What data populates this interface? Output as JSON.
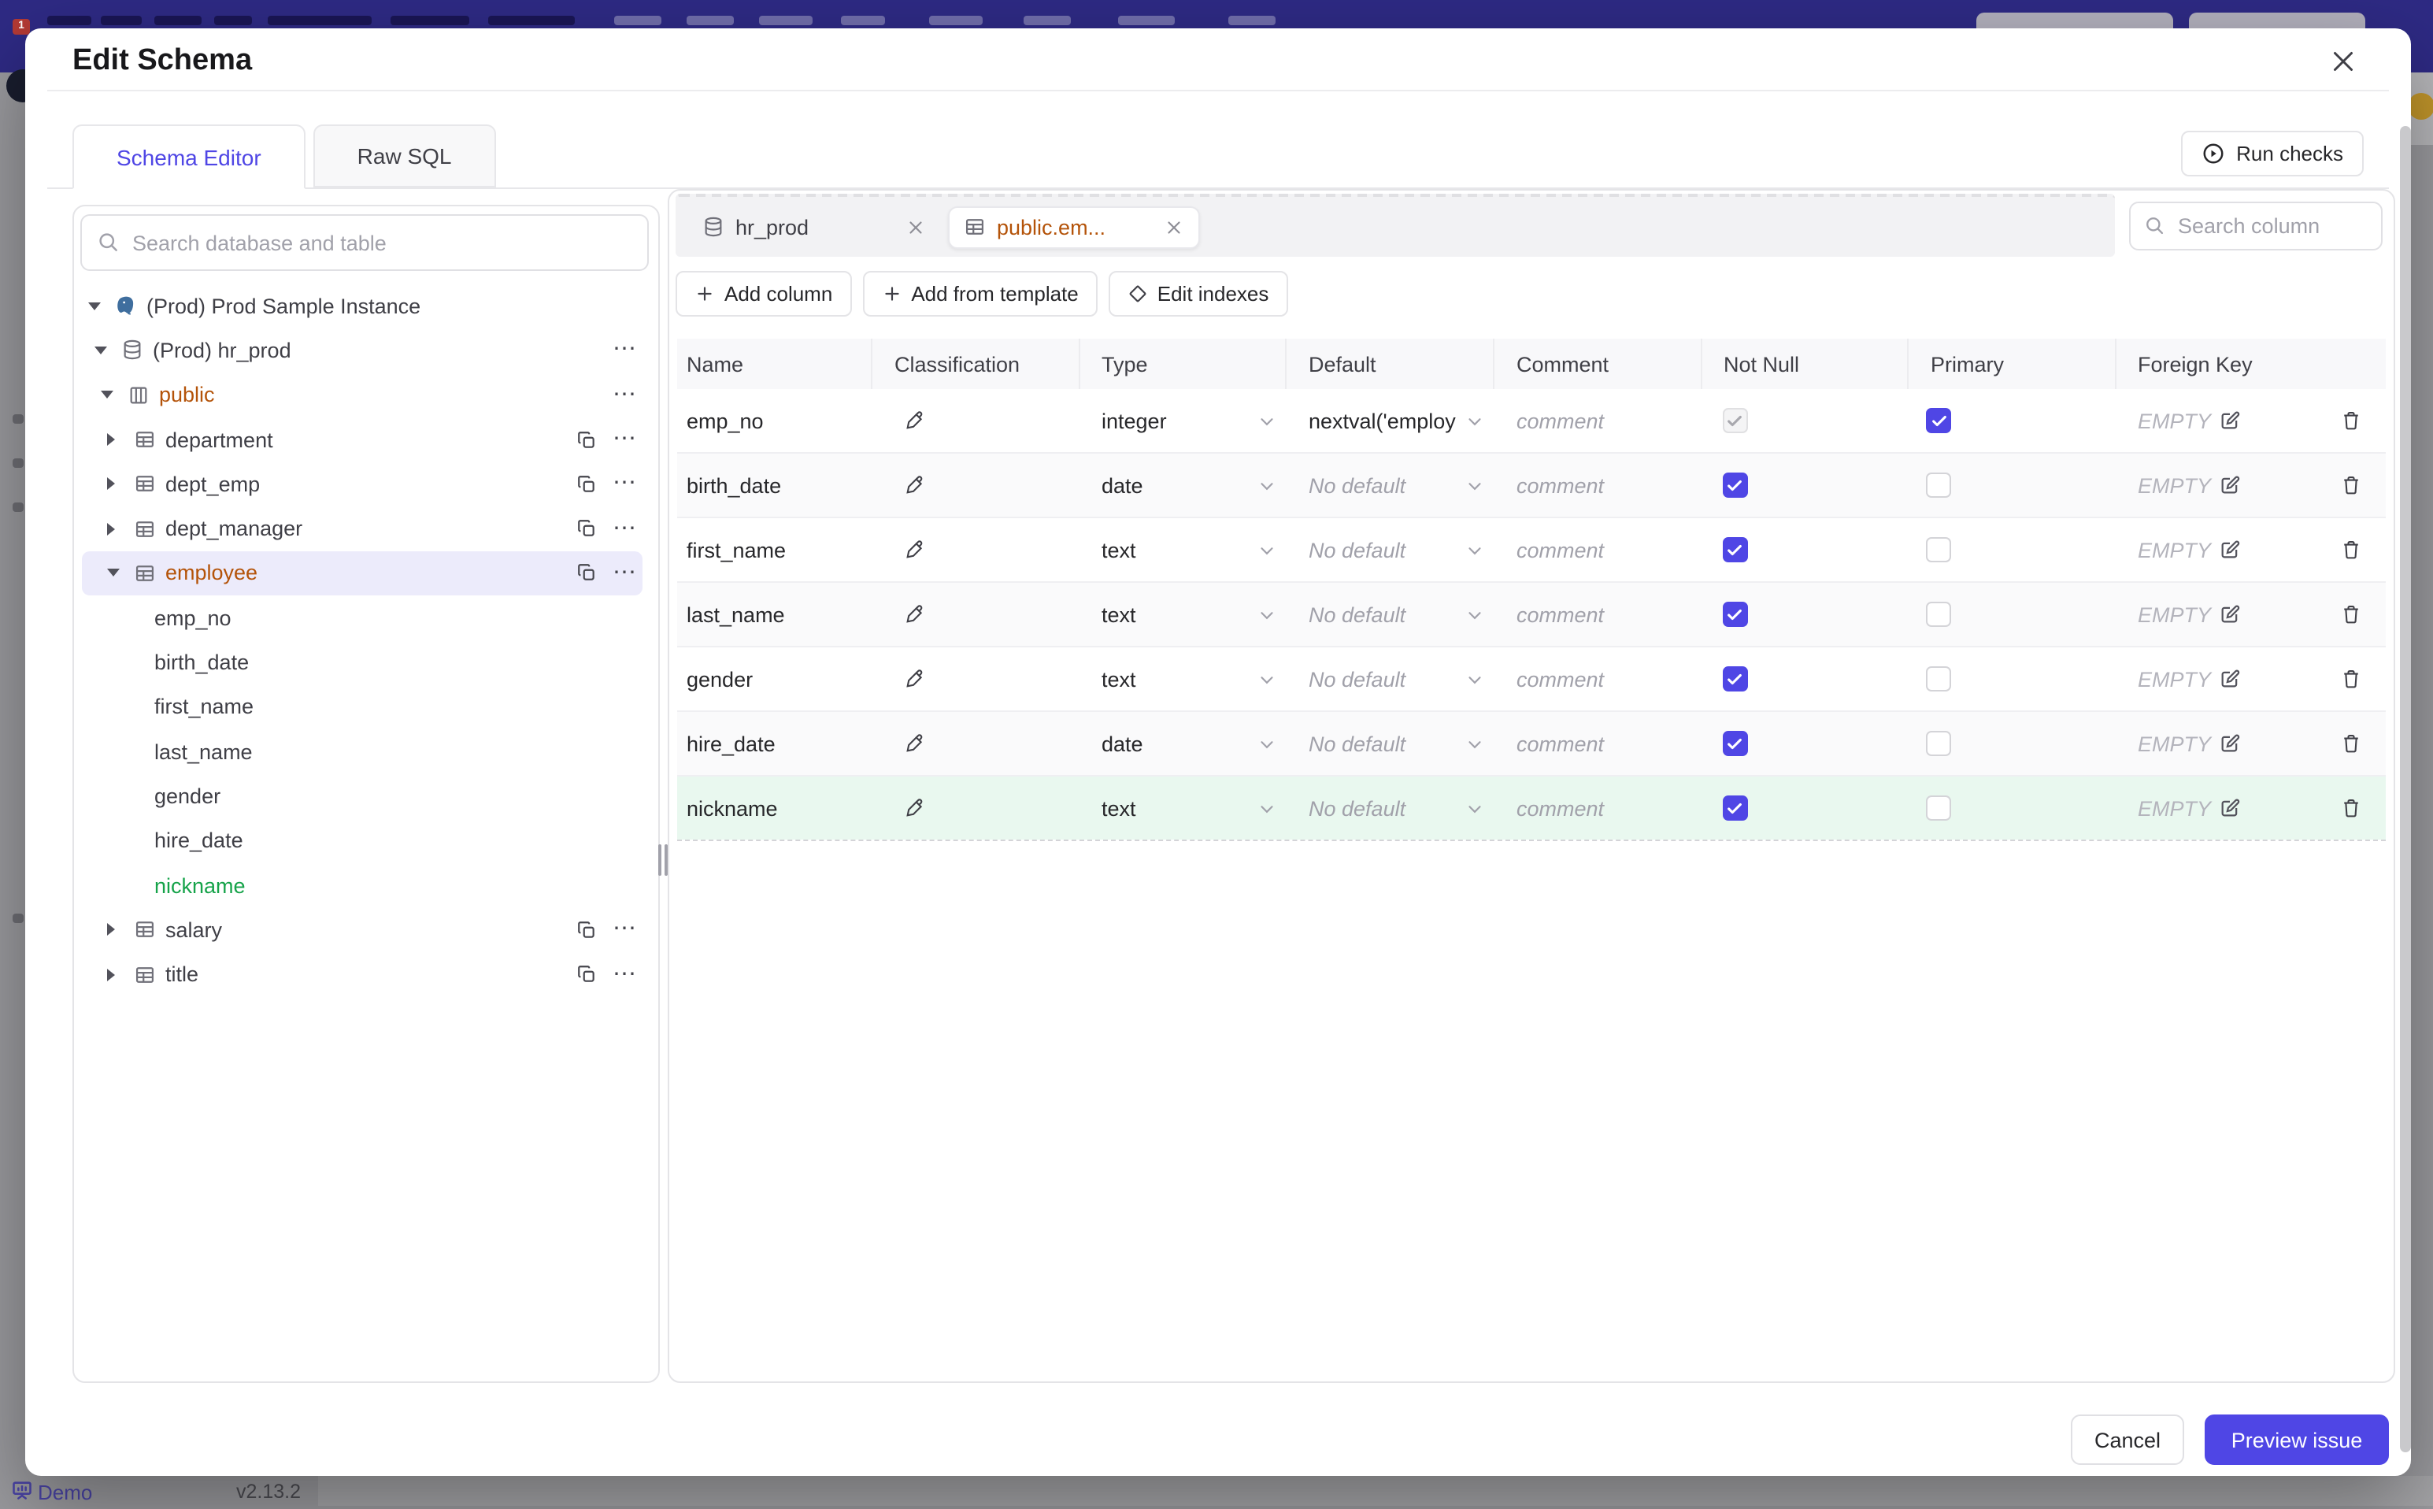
{
  "underlying": {
    "demo_label": "Demo",
    "version": "v2.13.2"
  },
  "modal": {
    "title": "Edit Schema",
    "tabs": [
      {
        "label": "Schema Editor",
        "active": true
      },
      {
        "label": "Raw SQL",
        "active": false
      }
    ],
    "run_checks_label": "Run checks",
    "sidebar": {
      "search_placeholder": "Search database and table",
      "tree": [
        {
          "level": 0,
          "caret": "down",
          "icon": "postgres-icon",
          "label": "(Prod) Prod Sample Instance",
          "color": null,
          "selected": false,
          "actions": []
        },
        {
          "level": 1,
          "caret": "down",
          "icon": "database-icon",
          "label": "(Prod) hr_prod",
          "color": null,
          "selected": false,
          "actions": [
            "more"
          ]
        },
        {
          "level": 2,
          "caret": "down",
          "icon": "schema-icon",
          "label": "public",
          "color": "amber",
          "selected": false,
          "actions": [
            "more"
          ]
        },
        {
          "level": 3,
          "caret": "right",
          "icon": "table-icon",
          "label": "department",
          "color": null,
          "selected": false,
          "actions": [
            "copy",
            "more"
          ]
        },
        {
          "level": 3,
          "caret": "right",
          "icon": "table-icon",
          "label": "dept_emp",
          "color": null,
          "selected": false,
          "actions": [
            "copy",
            "more"
          ]
        },
        {
          "level": 3,
          "caret": "right",
          "icon": "table-icon",
          "label": "dept_manager",
          "color": null,
          "selected": false,
          "actions": [
            "copy",
            "more"
          ]
        },
        {
          "level": 3,
          "caret": "down",
          "icon": "table-icon",
          "label": "employee",
          "color": "amber",
          "selected": true,
          "actions": [
            "copy",
            "more"
          ]
        },
        {
          "level": 4,
          "caret": null,
          "icon": null,
          "label": "emp_no",
          "color": null,
          "selected": false,
          "actions": []
        },
        {
          "level": 4,
          "caret": null,
          "icon": null,
          "label": "birth_date",
          "color": null,
          "selected": false,
          "actions": []
        },
        {
          "level": 4,
          "caret": null,
          "icon": null,
          "label": "first_name",
          "color": null,
          "selected": false,
          "actions": []
        },
        {
          "level": 4,
          "caret": null,
          "icon": null,
          "label": "last_name",
          "color": null,
          "selected": false,
          "actions": []
        },
        {
          "level": 4,
          "caret": null,
          "icon": null,
          "label": "gender",
          "color": null,
          "selected": false,
          "actions": []
        },
        {
          "level": 4,
          "caret": null,
          "icon": null,
          "label": "hire_date",
          "color": null,
          "selected": false,
          "actions": []
        },
        {
          "level": 4,
          "caret": null,
          "icon": null,
          "label": "nickname",
          "color": "green",
          "selected": false,
          "actions": []
        },
        {
          "level": 3,
          "caret": "right",
          "icon": "table-icon",
          "label": "salary",
          "color": null,
          "selected": false,
          "actions": [
            "copy",
            "more"
          ]
        },
        {
          "level": 3,
          "caret": "right",
          "icon": "table-icon",
          "label": "title",
          "color": null,
          "selected": false,
          "actions": [
            "copy",
            "more"
          ]
        }
      ]
    },
    "editor": {
      "chips": [
        {
          "icon": "database-icon",
          "label": "hr_prod",
          "active": false
        },
        {
          "icon": "table-icon",
          "label": "public.em...",
          "active": true
        }
      ],
      "action_buttons": [
        {
          "icon": "plus-icon",
          "label": "Add column"
        },
        {
          "icon": "plus-icon",
          "label": "Add from template"
        },
        {
          "icon": "diamond-icon",
          "label": "Edit indexes"
        }
      ],
      "column_search_placeholder": "Search column",
      "table": {
        "headers": [
          "Name",
          "Classification",
          "Type",
          "Default",
          "Comment",
          "Not Null",
          "Primary",
          "Foreign Key",
          ""
        ],
        "comment_placeholder": "comment",
        "foreign_key_empty": "EMPTY",
        "rows": [
          {
            "name": "emp_no",
            "type": "integer",
            "default": "nextval('employ",
            "default_muted": false,
            "not_null": "checked-disabled",
            "primary": "checked",
            "new": false
          },
          {
            "name": "birth_date",
            "type": "date",
            "default": "No default",
            "default_muted": true,
            "not_null": "checked",
            "primary": "unchecked",
            "new": false
          },
          {
            "name": "first_name",
            "type": "text",
            "default": "No default",
            "default_muted": true,
            "not_null": "checked",
            "primary": "unchecked",
            "new": false
          },
          {
            "name": "last_name",
            "type": "text",
            "default": "No default",
            "default_muted": true,
            "not_null": "checked",
            "primary": "unchecked",
            "new": false
          },
          {
            "name": "gender",
            "type": "text",
            "default": "No default",
            "default_muted": true,
            "not_null": "checked",
            "primary": "unchecked",
            "new": false
          },
          {
            "name": "hire_date",
            "type": "date",
            "default": "No default",
            "default_muted": true,
            "not_null": "checked",
            "primary": "unchecked",
            "new": false
          },
          {
            "name": "nickname",
            "type": "text",
            "default": "No default",
            "default_muted": true,
            "not_null": "checked",
            "primary": "unchecked",
            "new": true
          }
        ]
      }
    },
    "footer": {
      "cancel_label": "Cancel",
      "primary_label": "Preview issue"
    },
    "accent_color": "#4f46e5",
    "amber_color": "#b45309",
    "green_color": "#16a34a"
  }
}
